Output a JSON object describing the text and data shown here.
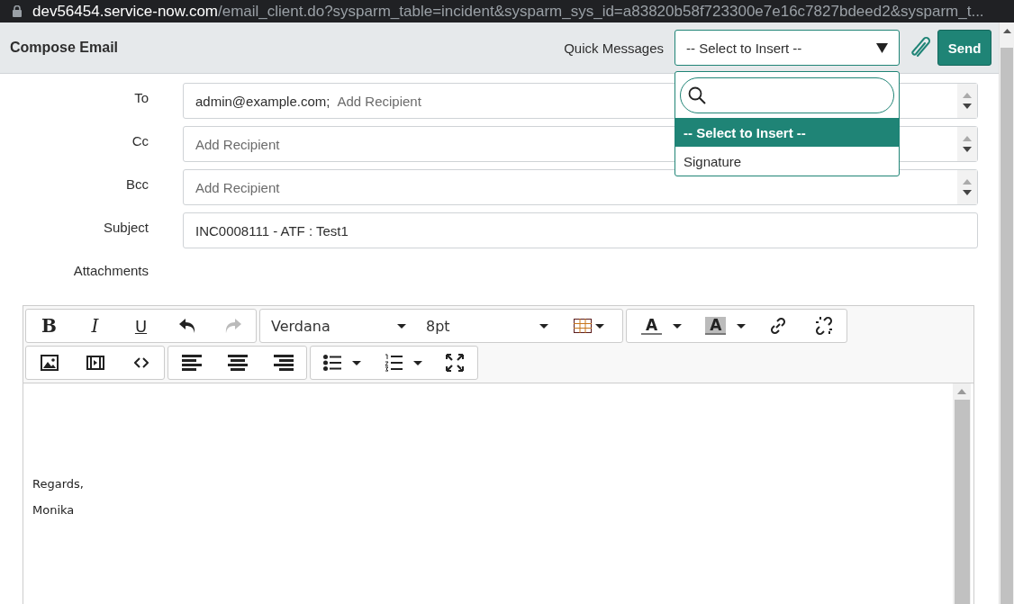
{
  "address_bar": {
    "url_host": "dev56454.service-now.com",
    "url_path": "/email_client.do?sysparm_table=incident&sysparm_sys_id=a83820b58f723300e7e16c7827bdeed2&sysparm_t..."
  },
  "header": {
    "title": "Compose Email",
    "quick_messages_label": "Quick Messages",
    "quick_messages_value": "-- Select to Insert --",
    "send_button": "Send",
    "dropdown": {
      "options": [
        {
          "label": "-- Select to Insert --",
          "selected": true
        },
        {
          "label": "Signature",
          "selected": false
        }
      ]
    }
  },
  "fields": [
    {
      "kind": "recipients",
      "label": "To",
      "recipients": [
        "admin@example.com;"
      ],
      "placeholder": "Add Recipient"
    },
    {
      "kind": "recipients",
      "label": "Cc",
      "placeholder": "Add Recipient"
    },
    {
      "kind": "recipients",
      "label": "Bcc",
      "placeholder": "Add Recipient"
    },
    {
      "kind": "text",
      "label": "Subject",
      "value": "INC0008111 - ATF : Test1"
    },
    {
      "kind": "attachments",
      "label": "Attachments"
    }
  ],
  "toolbar": {
    "bold": "B",
    "italic": "I",
    "underline": "U",
    "undo_disabled": false,
    "redo_disabled": true,
    "font": "Verdana",
    "size": "8pt",
    "text_color": "A",
    "background_color": "A"
  },
  "body": {
    "lines": [
      "Regards,",
      "Monika"
    ]
  }
}
